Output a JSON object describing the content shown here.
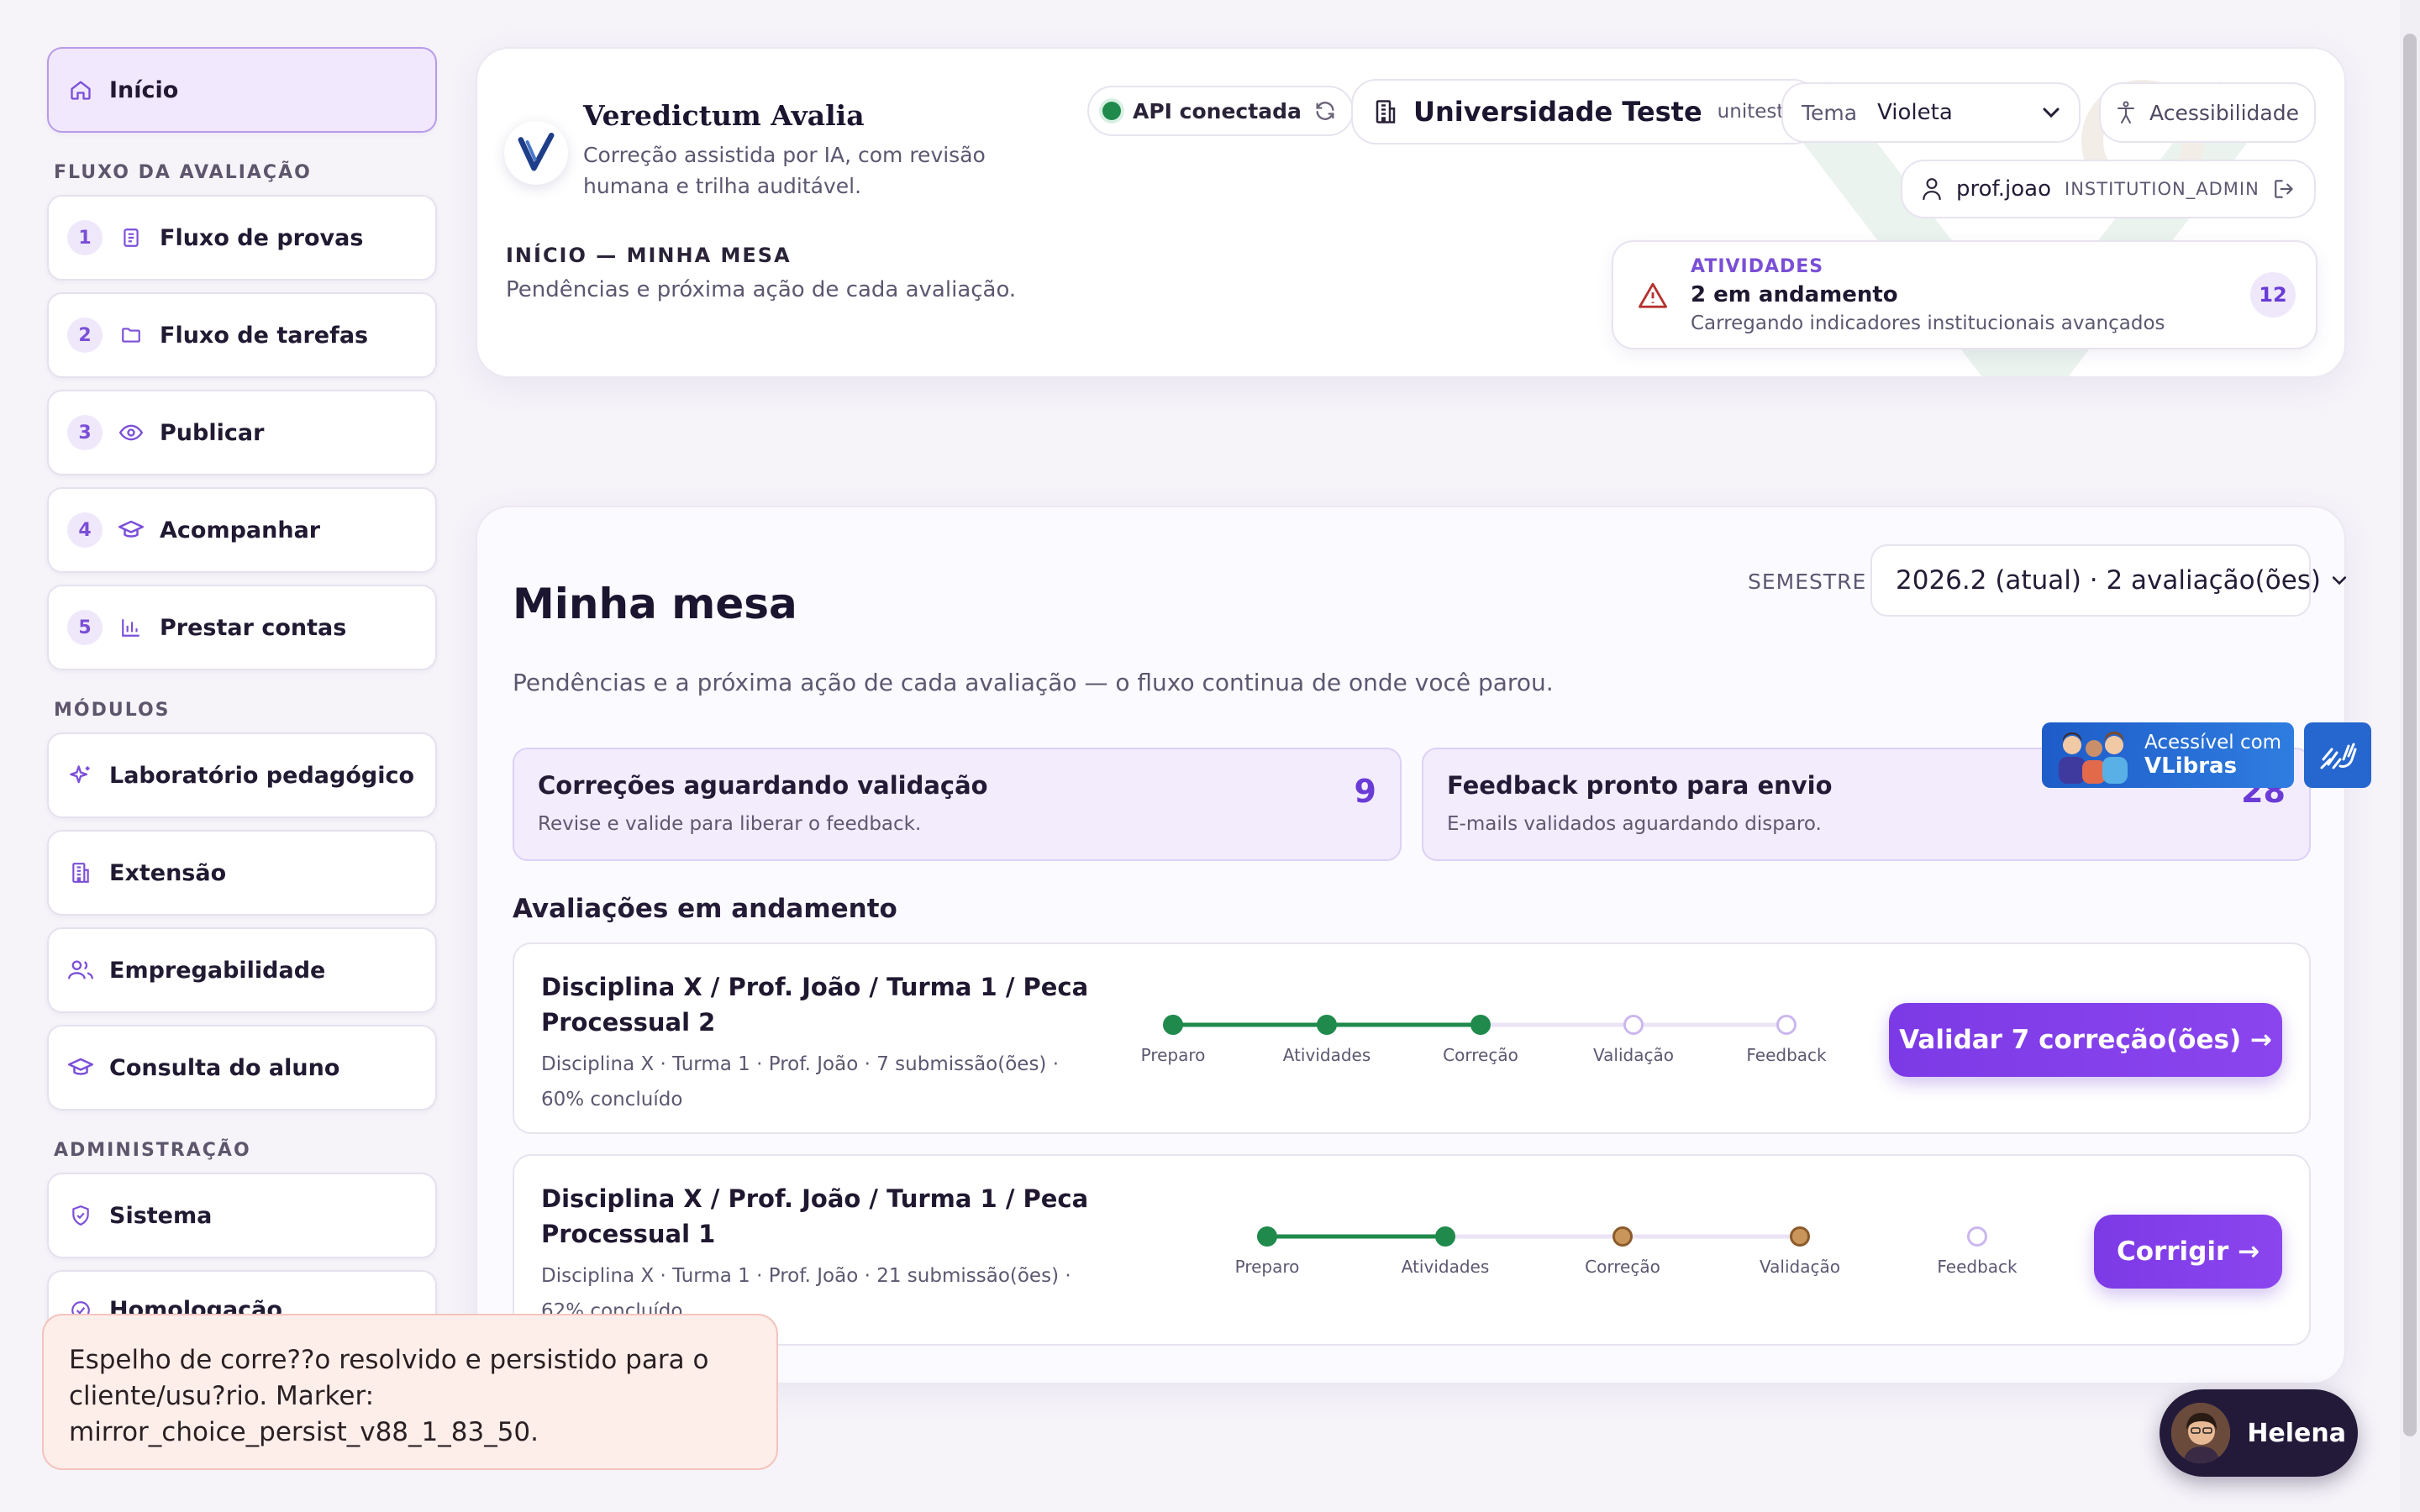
{
  "sidebar": {
    "home_label": "Início",
    "section_flow": "FLUXO DA AVALIAÇÃO",
    "flow_items": [
      {
        "num": "1",
        "label": "Fluxo de provas"
      },
      {
        "num": "2",
        "label": "Fluxo de tarefas"
      },
      {
        "num": "3",
        "label": "Publicar"
      },
      {
        "num": "4",
        "label": "Acompanhar"
      },
      {
        "num": "5",
        "label": "Prestar contas"
      }
    ],
    "section_modules": "MÓDULOS",
    "module_items": [
      {
        "label": "Laboratório pedagógico"
      },
      {
        "label": "Extensão"
      },
      {
        "label": "Empregabilidade"
      },
      {
        "label": "Consulta do aluno"
      }
    ],
    "section_admin": "ADMINISTRAÇÃO",
    "admin_items": [
      {
        "label": "Sistema"
      },
      {
        "label": "Homologação"
      }
    ]
  },
  "header": {
    "app_name": "Veredictum Avalia",
    "tagline": "Correção assistida por IA, com revisão humana e trilha auditável.",
    "breadcrumb": "INÍCIO — MINHA MESA",
    "breadcrumb_sub": "Pendências e próxima ação de cada avaliação.",
    "api_status": "API conectada",
    "institution_name": "Universidade Teste",
    "institution_code": "uniteste",
    "theme_label": "Tema",
    "theme_value": "Violeta",
    "accessibility_label": "Acessibilidade",
    "user_name": "prof.joao",
    "user_role": "INSTITUTION_ADMIN",
    "activities": {
      "label": "ATIVIDADES",
      "title": "2 em andamento",
      "sub": "Carregando indicadores institucionais avançados",
      "count": "12"
    }
  },
  "main": {
    "title": "Minha mesa",
    "subtitle": "Pendências e a próxima ação de cada avaliação — o fluxo continua de onde você parou.",
    "semester_label": "SEMESTRE",
    "semester_value": "2026.2 (atual) · 2 avaliação(ões)",
    "stats": [
      {
        "title": "Correções aguardando validação",
        "sub": "Revise e valide para liberar o feedback.",
        "count": "9"
      },
      {
        "title": "Feedback pronto para envio",
        "sub": "E-mails validados aguardando disparo.",
        "count": "28"
      }
    ],
    "section_title": "Avaliações em andamento",
    "evaluations": [
      {
        "title": "Disciplina X / Prof. João / Turma 1 / Peca Processual 2",
        "sub": "Disciplina X · Turma 1 · Prof. João · 7 submissão(ões) · 60% concluído",
        "steps": [
          "Preparo",
          "Atividades",
          "Correção",
          "Validação",
          "Feedback"
        ],
        "cta": "Validar 7 correção(ões) →"
      },
      {
        "title": "Disciplina X / Prof. João / Turma 1 / Peca Processual 1",
        "sub": "Disciplina X · Turma 1 · Prof. João · 21 submissão(ões) · 62% concluído",
        "steps": [
          "Preparo",
          "Atividades",
          "Correção",
          "Validação",
          "Feedback"
        ],
        "cta": "Corrigir →"
      }
    ]
  },
  "vlibras": {
    "line1": "Acessível com",
    "line2": "VLibras"
  },
  "assistant": {
    "name": "Helena"
  },
  "toast": {
    "message": "Espelho de corre??o resolvido e persistido para o cliente/usu?rio. Marker: mirror_choice_persist_v88_1_83_50."
  },
  "colors": {
    "accent": "#7c3ae6",
    "done": "#1f8a4c",
    "warning": "#c9955a",
    "toast_bg": "#fdeeea"
  }
}
